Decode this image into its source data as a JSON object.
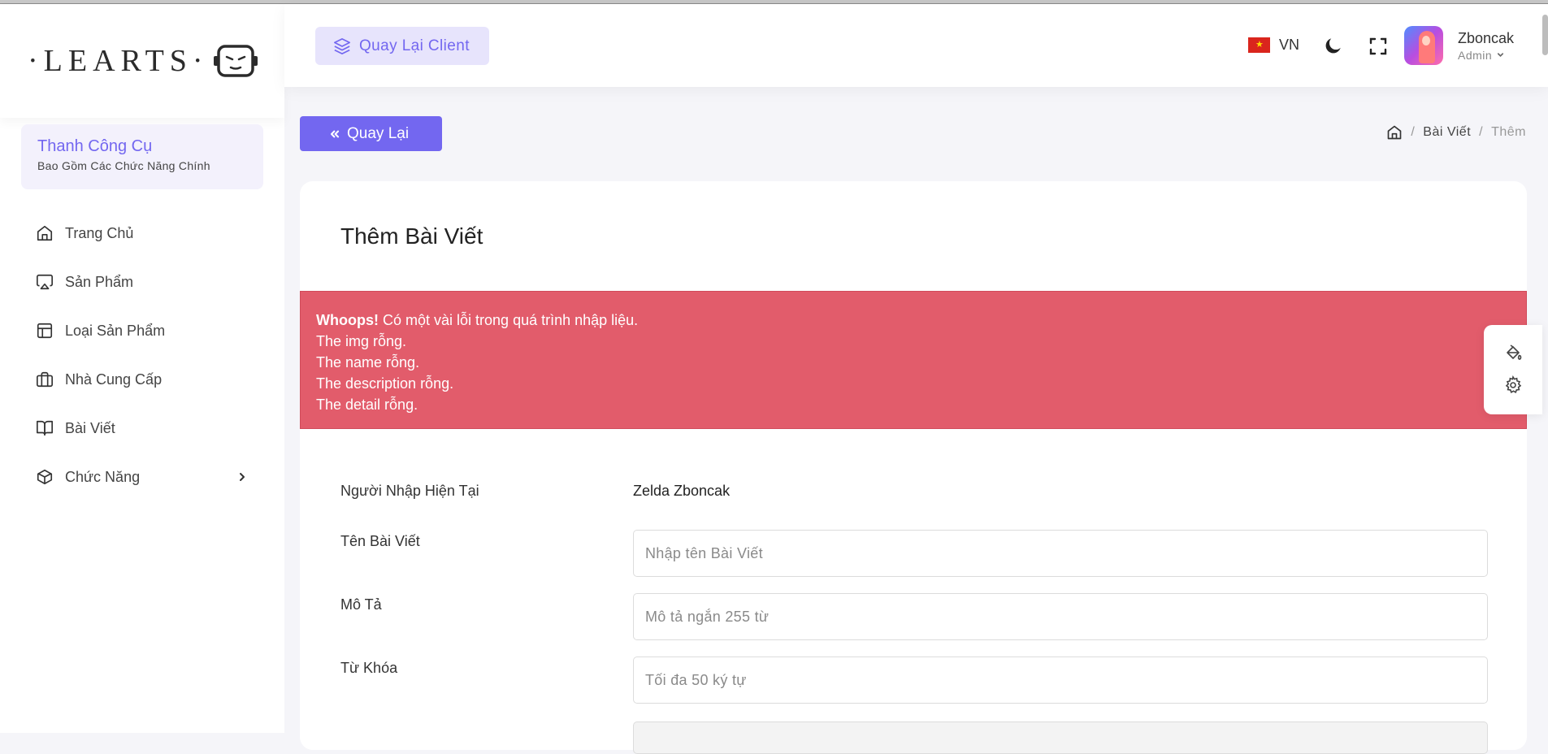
{
  "brand": {
    "logo_text": "·LEARTS·"
  },
  "sidebar": {
    "toolbar_title": "Thanh Công Cụ",
    "toolbar_subtitle": "Bao Gồm Các Chức Năng Chính",
    "items": [
      {
        "label": "Trang Chủ",
        "icon": "home-icon"
      },
      {
        "label": "Sản Phẩm",
        "icon": "airplay-icon"
      },
      {
        "label": "Loại Sản Phẩm",
        "icon": "layout-icon"
      },
      {
        "label": "Nhà Cung Cấp",
        "icon": "briefcase-icon"
      },
      {
        "label": "Bài Viết",
        "icon": "book-open-icon"
      },
      {
        "label": "Chức Năng",
        "icon": "box-icon"
      }
    ]
  },
  "header": {
    "client_button": "Quay Lại Client",
    "language": "VN",
    "user_name": "Zboncak",
    "user_role": "Admin"
  },
  "main": {
    "back_button": "Quay Lại",
    "breadcrumb": {
      "item1": "Bài Viết",
      "active": "Thêm"
    },
    "card_title": "Thêm Bài Viết",
    "alert": {
      "strong": "Whoops!",
      "message": "Có một vài lỗi trong quá trình nhập liệu.",
      "errors": [
        "The img rỗng.",
        "The name rỗng.",
        "The description rỗng.",
        "The detail rỗng."
      ]
    },
    "form": {
      "author_label": "Người Nhập Hiện Tại",
      "author_value": "Zelda Zboncak",
      "title_label": "Tên Bài Viết",
      "title_placeholder": "Nhập tên Bài Viết",
      "desc_label": "Mô Tả",
      "desc_placeholder": "Mô tả ngắn 255 từ",
      "keyword_label": "Từ Khóa",
      "keyword_placeholder": "Tối đa 50 ký tự"
    }
  },
  "colors": {
    "primary": "#7367f0",
    "danger": "#e25c6b",
    "primary_light": "#e7e4fc"
  }
}
